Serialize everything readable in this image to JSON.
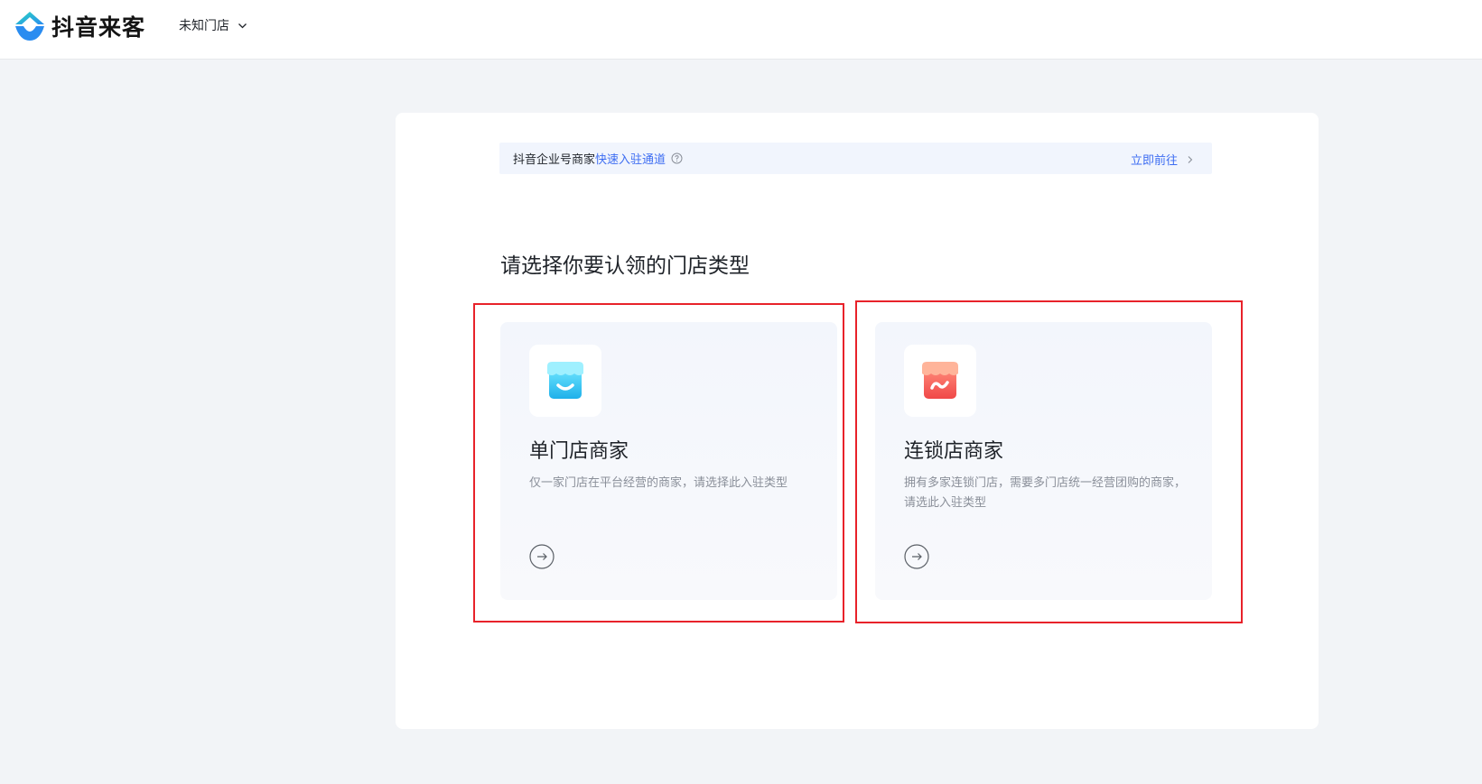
{
  "header": {
    "brand": "抖音来客",
    "store_selector": "未知门店"
  },
  "notice": {
    "prefix": "抖音企业号商家",
    "link": "快速入驻通道",
    "action": "立即前往"
  },
  "page_title": "请选择你要认领的门店类型",
  "cards": [
    {
      "title": "单门店商家",
      "description": "仅一家门店在平台经营的商家，请选择此入驻类型"
    },
    {
      "title": "连锁店商家",
      "description": "拥有多家连锁门店，需要多门店统一经营团购的商家，请选此入驻类型"
    }
  ],
  "colors": {
    "accent": "#3d6df2",
    "highlight_box": "#e8222a",
    "single_store_icon": "#2ec6f0",
    "chain_store_icon": "#f25a5a"
  }
}
